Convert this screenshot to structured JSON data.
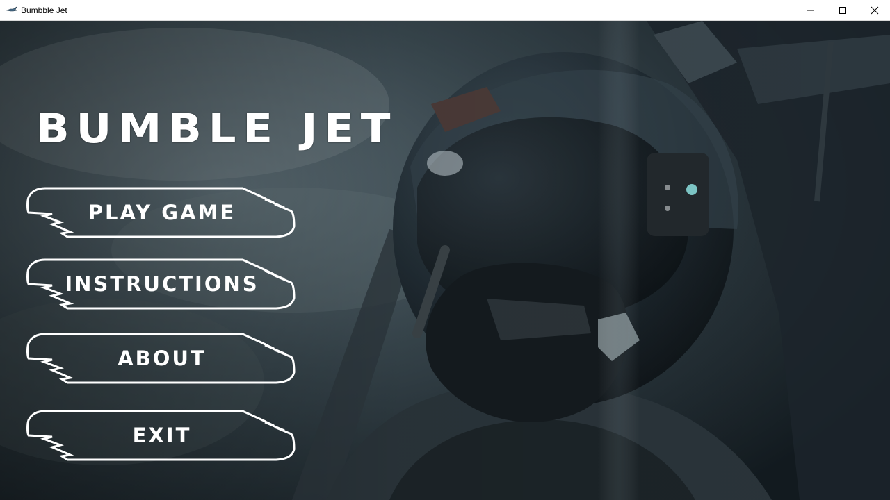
{
  "window": {
    "title": "Bumbble Jet"
  },
  "game": {
    "title": "BUMBLE JET"
  },
  "menu": {
    "items": [
      {
        "label": "PLAY GAME"
      },
      {
        "label": "INSTRUCTIONS"
      },
      {
        "label": "ABOUT"
      },
      {
        "label": "EXIT"
      }
    ]
  },
  "icons": {
    "app": "jet-icon",
    "minimize": "minimize-icon",
    "maximize": "maximize-icon",
    "close": "close-icon"
  },
  "colors": {
    "title_text": "#ffffff",
    "button_outline": "#ffffff",
    "background_dark": "#0d1216"
  }
}
